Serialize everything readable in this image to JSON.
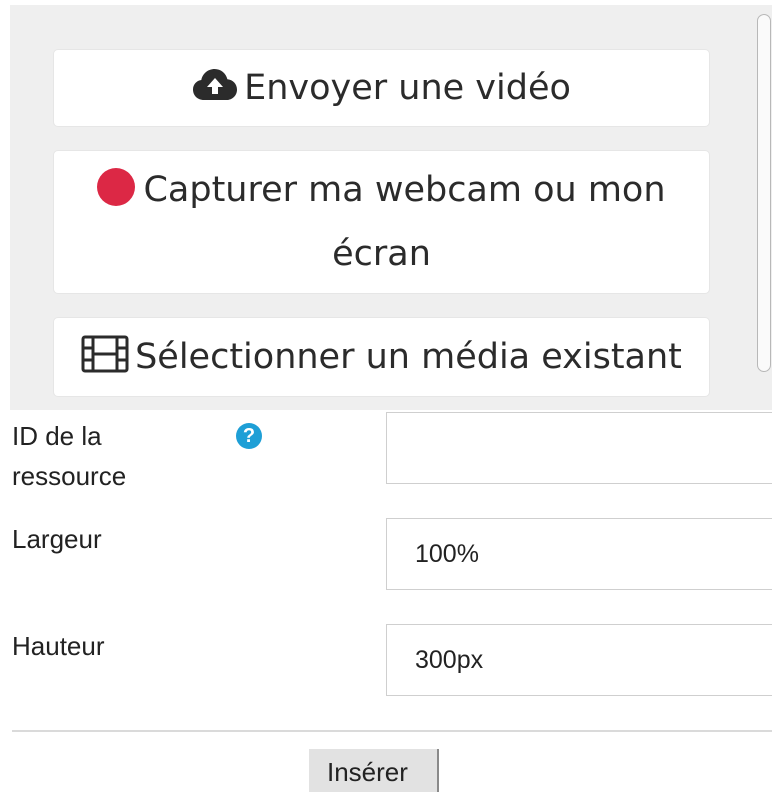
{
  "media": {
    "upload_label": "Envoyer une vidéo",
    "upload_icon": "cloud-upload-icon",
    "capture_label": "Capturer ma webcam ou mon écran",
    "capture_icon": "record-dot-icon",
    "capture_icon_color": "#dc2845",
    "select_label": "Sélectionner un média existant",
    "select_icon": "film-icon"
  },
  "form": {
    "resource_id_label": "ID de la ressource",
    "resource_id_help_icon": "question-circle-icon",
    "resource_id_help_glyph": "?",
    "resource_id_value": "",
    "width_label": "Largeur",
    "width_value": "100%",
    "height_label": "Hauteur",
    "height_value": "300px",
    "help_icon_color": "#1e9fd6"
  },
  "actions": {
    "insert_label": "Insérer"
  }
}
